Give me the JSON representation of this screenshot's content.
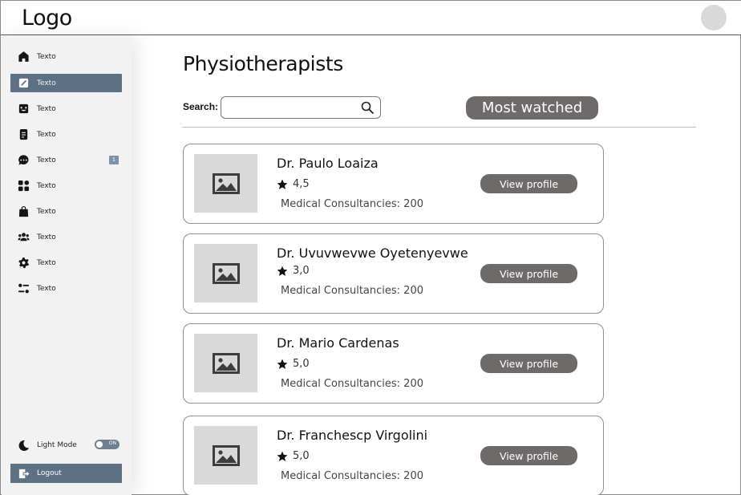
{
  "header": {
    "logo": "Logo"
  },
  "sidebar": {
    "items": [
      {
        "label": "Texto",
        "icon": "home-icon"
      },
      {
        "label": "Texto",
        "icon": "edit-icon",
        "active": true
      },
      {
        "label": "Texto",
        "icon": "face-icon"
      },
      {
        "label": "Texto",
        "icon": "document-icon"
      },
      {
        "label": "Texto",
        "icon": "chat-icon",
        "badge": "1"
      },
      {
        "label": "Texto",
        "icon": "apps-icon"
      },
      {
        "label": "Texto",
        "icon": "bag-icon"
      },
      {
        "label": "Texto",
        "icon": "users-icon"
      },
      {
        "label": "Texto",
        "icon": "gear-icon"
      },
      {
        "label": "Texto",
        "icon": "filters-icon"
      }
    ],
    "light_mode": {
      "label": "Light Mode",
      "toggle_text": "ON",
      "on": true
    },
    "logout": {
      "label": "Logout"
    }
  },
  "main": {
    "title": "Physiotherapists",
    "search": {
      "label": "Search:",
      "placeholder": "",
      "value": ""
    },
    "sort_button": "Most watched",
    "doctors": [
      {
        "name": "Dr. Paulo Loaiza",
        "rating": "4,5",
        "consultancies": "Medical Consultancies: 200",
        "button": "View profile"
      },
      {
        "name": "Dr. Uvuvwevwe Oyetenyevwe",
        "rating": "3,0",
        "consultancies": "Medical Consultancies: 200",
        "button": "View profile"
      },
      {
        "name": "Dr. Mario Cardenas",
        "rating": "5,0",
        "consultancies": "Medical Consultancies: 200",
        "button": "View profile"
      },
      {
        "name": "Dr. Franchescp Virgolini",
        "rating": "5,0",
        "consultancies": "Medical Consultancies: 200",
        "button": "View profile"
      }
    ]
  },
  "colors": {
    "accent": "#5c7184",
    "button": "#6e6a6a",
    "sidebar_bg": "#f2f2f2"
  }
}
